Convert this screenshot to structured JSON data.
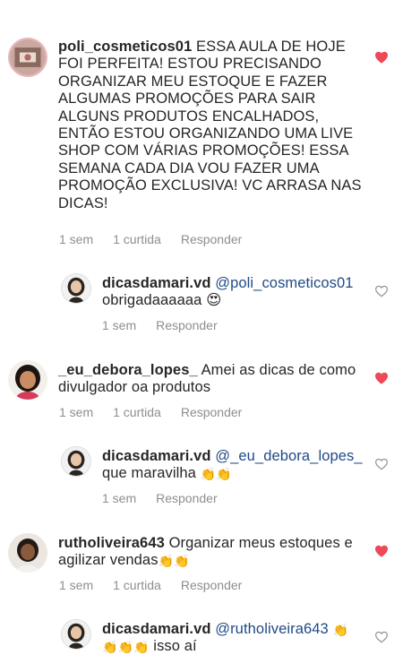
{
  "comments": [
    {
      "username": "poli_cosmeticos01",
      "text": "ESSA AULA DE HOJE FOI PERFEITA! ESTOU PRECISANDO ORGANIZAR MEU ESTOQUE E FAZER ALGUMAS PROMOÇÕES PARA SAIR ALGUNS PRODUTOS ENCALHADOS, ENTÃO ESTOU ORGANIZANDO UMA LIVE SHOP COM VÁRIAS PROMOÇÕES! ESSA SEMANA CADA DIA VOU FAZER UMA PROMOÇÃO EXCLUSIVA! VC ARRASA NAS DICAS!",
      "time": "1 sem",
      "likes": "1 curtida",
      "reply": "Responder",
      "liked": true
    },
    {
      "username": "dicasdamari.vd",
      "mention": "@poli_cosmeticos01",
      "text": "obrigadaaaaaa 😍",
      "time": "1 sem",
      "reply": "Responder",
      "liked": false
    },
    {
      "username": "_eu_debora_lopes_",
      "text": "Amei as dicas de como divulgador oa produtos",
      "time": "1 sem",
      "likes": "1 curtida",
      "reply": "Responder",
      "liked": true
    },
    {
      "username": "dicasdamari.vd",
      "mention": "@_eu_debora_lopes_",
      "text": "que maravilha",
      "emoji": "👏👏",
      "time": "1 sem",
      "reply": "Responder",
      "liked": false
    },
    {
      "username": "rutholiveira643",
      "text": "Organizar meus estoques e agilizar vendas",
      "emoji": "👏👏",
      "time": "1 sem",
      "likes": "1 curtida",
      "reply": "Responder",
      "liked": true
    },
    {
      "username": "dicasdamari.vd",
      "mention": "@rutholiveira643",
      "emoji_a": "👏",
      "emoji_b": "👏👏👏",
      "text": "isso aí",
      "liked": false
    }
  ],
  "colors": {
    "heart_liked": "#ed4956",
    "heart_empty": "#8e8e8e",
    "meta_gray": "#8e8e8e",
    "mention_blue": "#1e4a86"
  }
}
